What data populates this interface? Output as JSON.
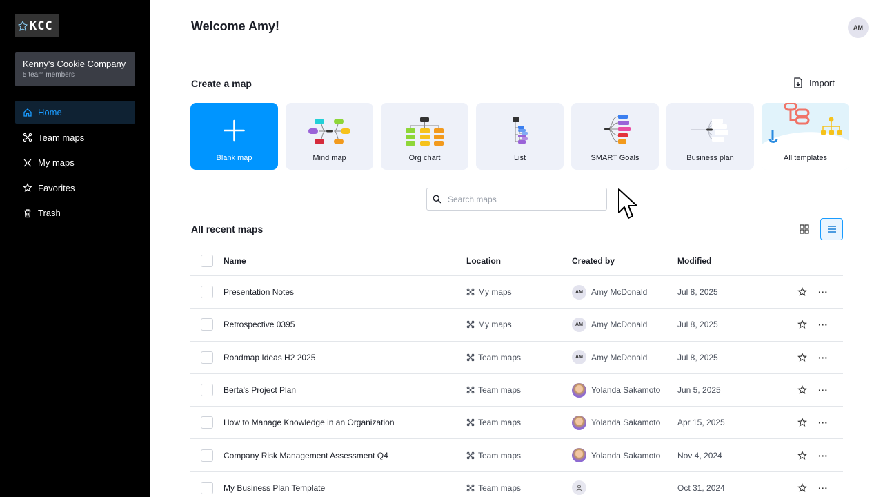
{
  "logo": {
    "text": "KCC"
  },
  "team": {
    "name": "Kenny's Cookie Company",
    "members": "5 team members"
  },
  "nav": [
    {
      "label": "Home",
      "icon": "home-icon",
      "active": true
    },
    {
      "label": "Team maps",
      "icon": "team-maps-icon",
      "active": false
    },
    {
      "label": "My maps",
      "icon": "my-maps-icon",
      "active": false
    },
    {
      "label": "Favorites",
      "icon": "star-icon",
      "active": false
    },
    {
      "label": "Trash",
      "icon": "trash-icon",
      "active": false
    }
  ],
  "header": {
    "welcome": "Welcome Amy!",
    "avatar_initials": "AM"
  },
  "create": {
    "title": "Create a map",
    "import_label": "Import",
    "templates": [
      {
        "label": "Blank map"
      },
      {
        "label": "Mind map"
      },
      {
        "label": "Org chart"
      },
      {
        "label": "List"
      },
      {
        "label": "SMART Goals"
      },
      {
        "label": "Business plan"
      },
      {
        "label": "All templates"
      }
    ]
  },
  "search": {
    "placeholder": "Search maps",
    "value": ""
  },
  "recent": {
    "title": "All recent maps",
    "columns": {
      "name": "Name",
      "location": "Location",
      "created_by": "Created by",
      "modified": "Modified"
    },
    "rows": [
      {
        "name": "Presentation Notes",
        "location": "My maps",
        "created_by": "Amy McDonald",
        "initials": "AM",
        "modified": "Jul 8, 2025"
      },
      {
        "name": "Retrospective 0395",
        "location": "My maps",
        "created_by": "Amy McDonald",
        "initials": "AM",
        "modified": "Jul 8, 2025"
      },
      {
        "name": "Roadmap Ideas H2 2025",
        "location": "Team maps",
        "created_by": "Amy McDonald",
        "initials": "AM",
        "modified": "Jul 8, 2025"
      },
      {
        "name": "Berta's Project Plan",
        "location": "Team maps",
        "created_by": "Yolanda Sakamoto",
        "initials": "",
        "modified": "Jun 5, 2025"
      },
      {
        "name": "How to Manage Knowledge in an Organization",
        "location": "Team maps",
        "created_by": "Yolanda Sakamoto",
        "initials": "",
        "modified": "Apr 15, 2025"
      },
      {
        "name": "Company Risk Management Assessment Q4",
        "location": "Team maps",
        "created_by": "Yolanda Sakamoto",
        "initials": "",
        "modified": "Nov 4, 2024"
      },
      {
        "name": "My Business Plan Template",
        "location": "Team maps",
        "created_by": "",
        "initials": "",
        "modified": "Oct 31, 2024"
      }
    ]
  },
  "more_symbol": "···",
  "colors": {
    "accent": "#0095ff",
    "sidebar": "#000000",
    "active_nav_text": "#1a9cff"
  }
}
